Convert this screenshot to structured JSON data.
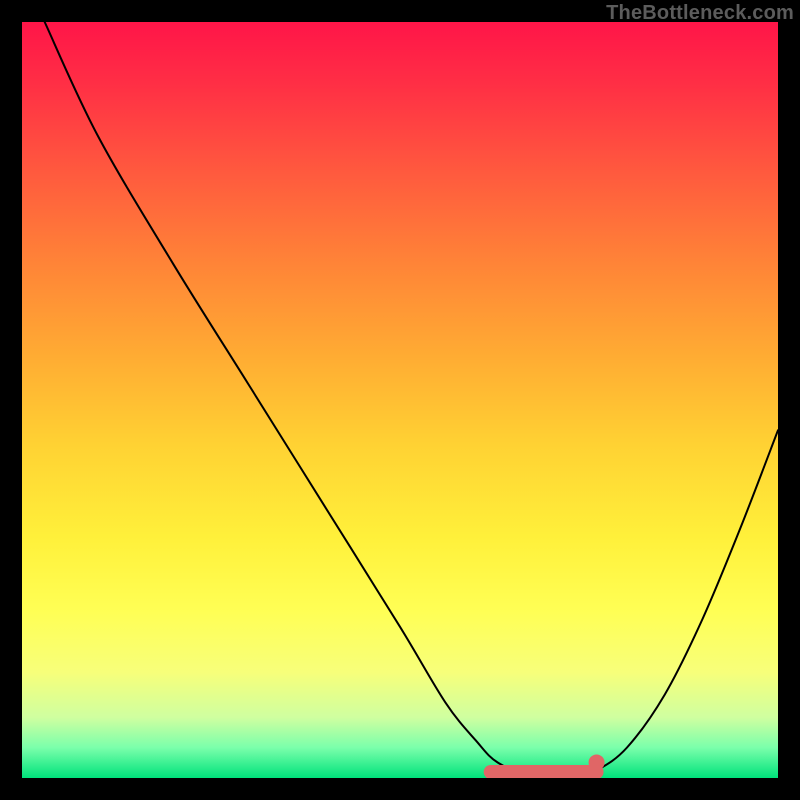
{
  "attribution": "TheBottleneck.com",
  "chart_data": {
    "type": "line",
    "title": "",
    "xlabel": "",
    "ylabel": "",
    "xlim": [
      0,
      100
    ],
    "ylim": [
      0,
      100
    ],
    "series": [
      {
        "name": "curve",
        "x": [
          3,
          10,
          20,
          30,
          40,
          50,
          56,
          60,
          63,
          68,
          73,
          76,
          80,
          85,
          90,
          95,
          100
        ],
        "values": [
          100,
          85,
          68,
          52,
          36,
          20,
          10,
          5,
          2,
          0,
          0,
          1,
          4,
          11,
          21,
          33,
          46
        ]
      }
    ],
    "highlight_band": {
      "x_start": 62,
      "x_end": 76,
      "y": 0
    },
    "highlight_dot": {
      "x": 76,
      "y": 1
    },
    "colors": {
      "curve": "#000000",
      "highlight": "#e06666"
    }
  }
}
